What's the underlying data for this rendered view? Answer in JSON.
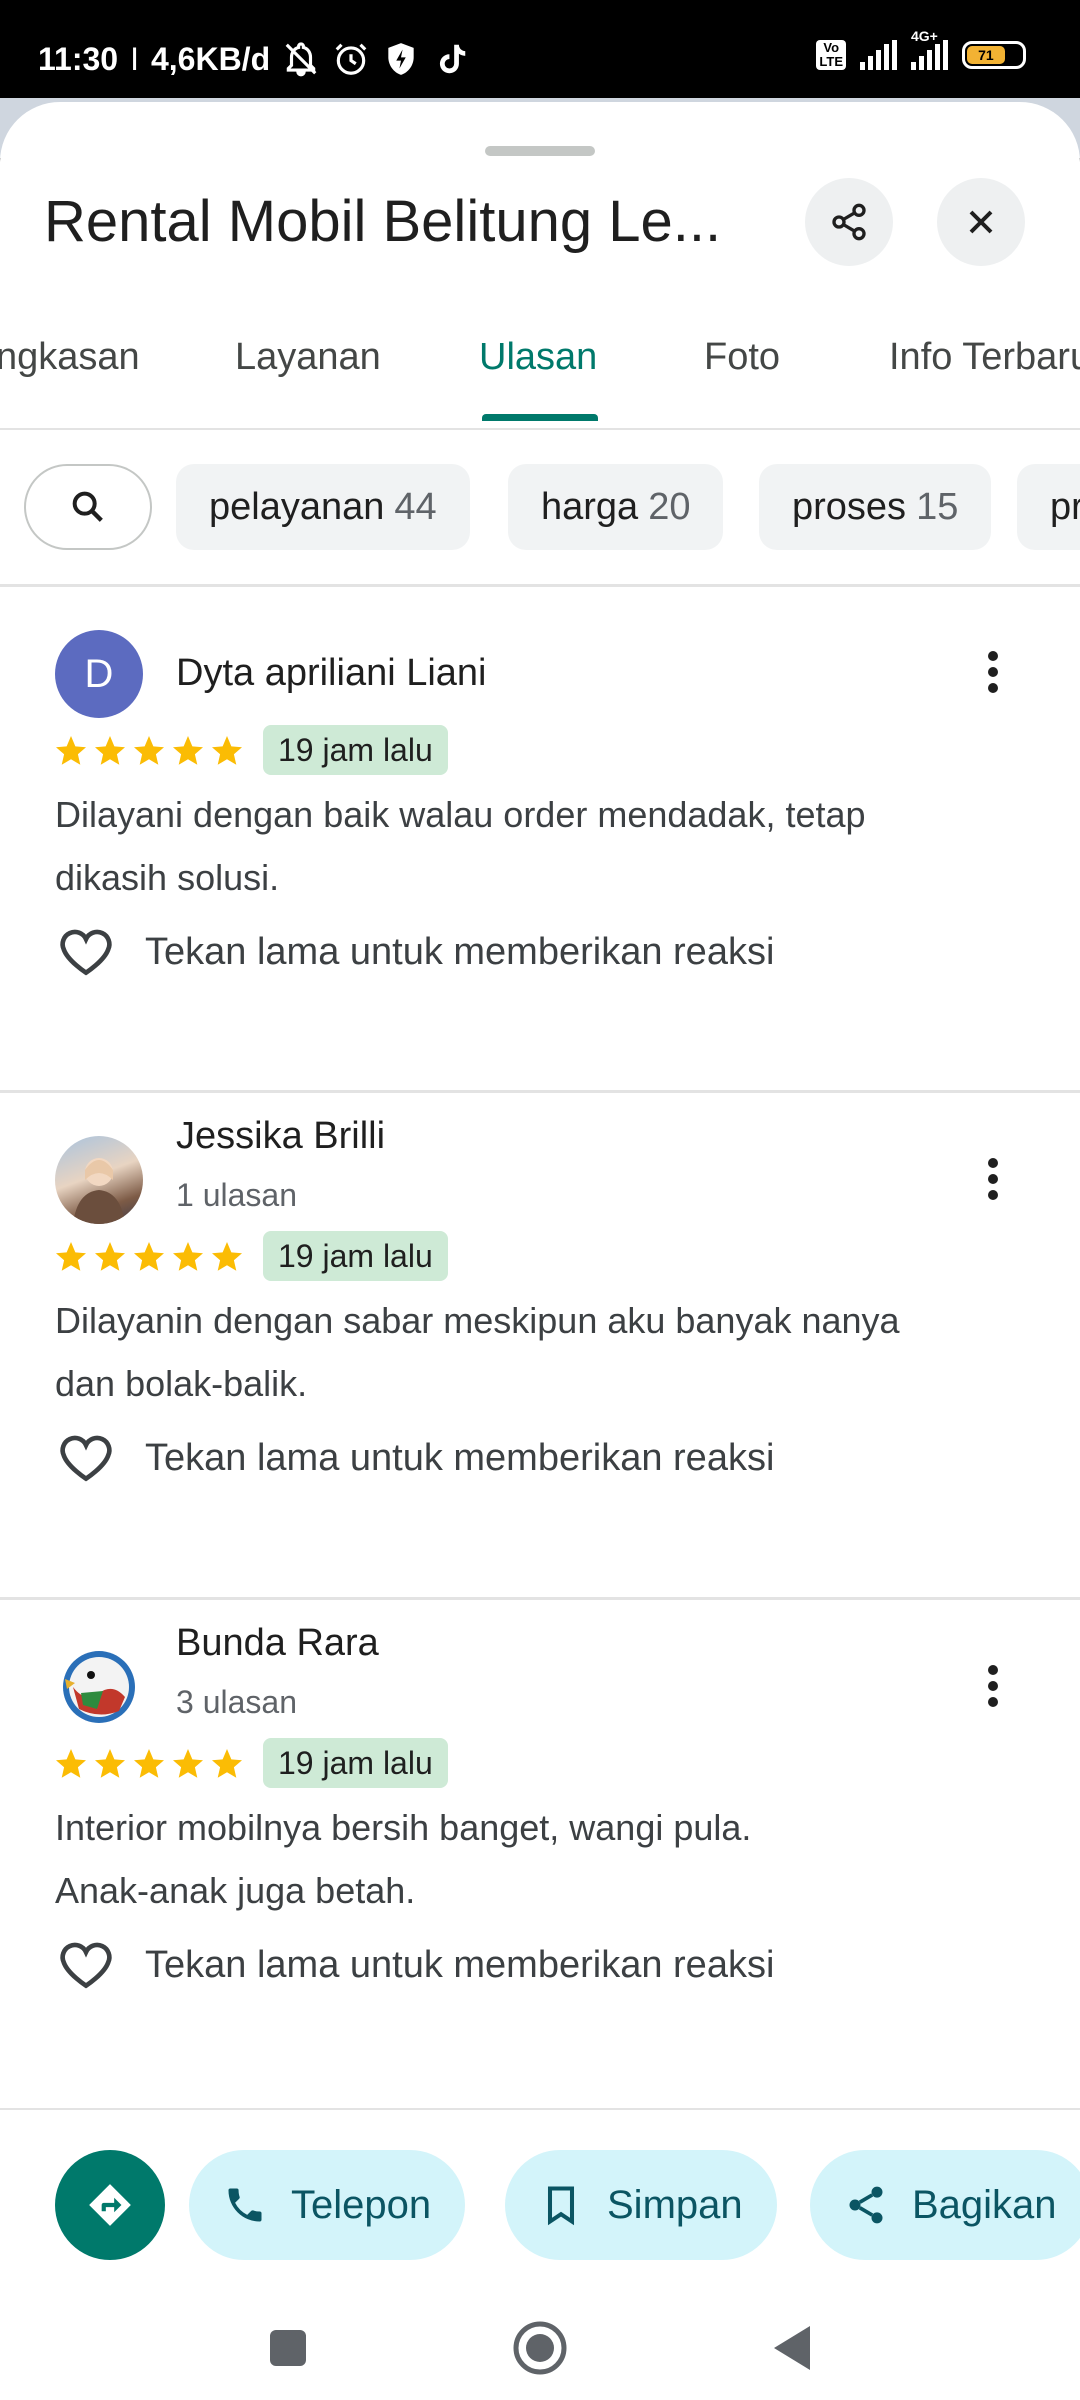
{
  "status_bar": {
    "time": "11:30",
    "separator": "I",
    "network_speed": "4,6KB/d",
    "signal_label_1": "Vo LTE",
    "signal_label_2": "4G+",
    "battery": "71"
  },
  "place": {
    "title": "Rental Mobil Belitung Le..."
  },
  "tabs": [
    {
      "label": "ngkasan"
    },
    {
      "label": "Layanan"
    },
    {
      "label": "Ulasan"
    },
    {
      "label": "Foto"
    },
    {
      "label": "Info Terbaru"
    }
  ],
  "active_tab": "Ulasan",
  "filter_chips": [
    {
      "label": "pelayanan",
      "count": "44"
    },
    {
      "label": "harga",
      "count": "20"
    },
    {
      "label": "proses",
      "count": "15"
    },
    {
      "label": "pr",
      "count": ""
    }
  ],
  "reviews": [
    {
      "name": "Dyta apriliani Liani",
      "avatar_letter": "D",
      "review_count": "",
      "rating": 5,
      "time": "19 jam lalu",
      "text_line1": "Dilayani dengan baik walau order mendadak, tetap",
      "text_line2": "dikasih solusi.",
      "reaction": "Tekan lama untuk memberikan reaksi"
    },
    {
      "name": "Jessika Brilli",
      "avatar_letter": "",
      "review_count": "1 ulasan",
      "rating": 5,
      "time": "19 jam lalu",
      "text_line1": "Dilayanin dengan sabar meskipun aku banyak nanya",
      "text_line2": "dan bolak-balik.",
      "reaction": "Tekan lama untuk memberikan reaksi"
    },
    {
      "name": "Bunda Rara",
      "avatar_letter": "",
      "review_count": "3 ulasan",
      "rating": 5,
      "time": "19 jam lalu",
      "text_line1": "Interior mobilnya bersih banget, wangi pula.",
      "text_line2": "Anak-anak juga betah.",
      "reaction": "Tekan lama untuk memberikan reaksi"
    }
  ],
  "actions": {
    "call": "Telepon",
    "save": "Simpan",
    "share": "Bagikan"
  },
  "colors": {
    "accent": "#00796b",
    "star": "#fbbc04",
    "badge_bg": "#ceead6",
    "pill_bg": "#d3f4fa",
    "avatar_d": "#5c6bc0"
  }
}
